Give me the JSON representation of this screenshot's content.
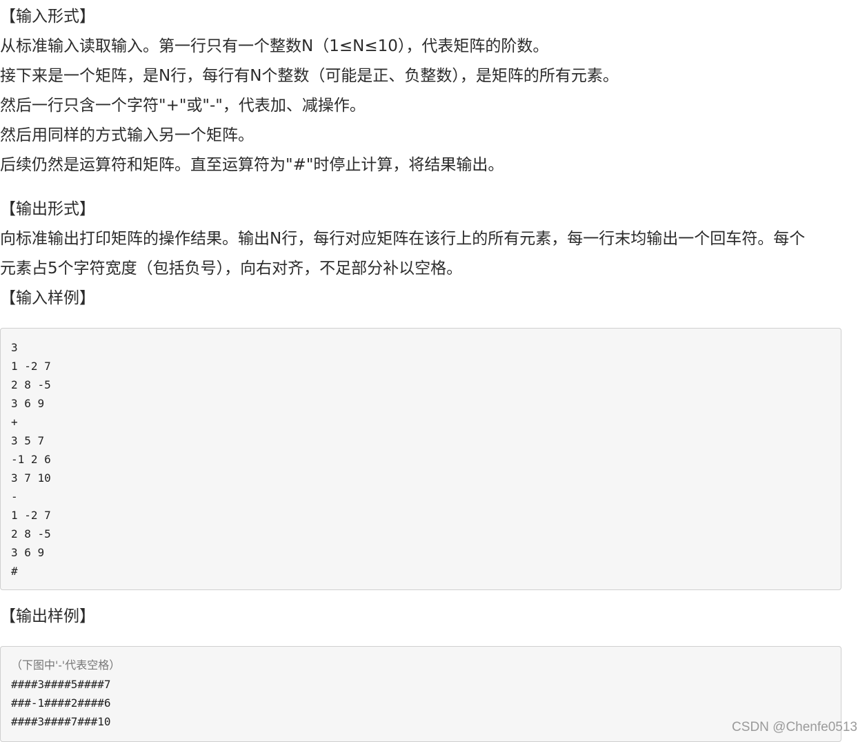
{
  "input_format": {
    "heading": "【输入形式】",
    "lines": [
      "从标准输入读取输入。第一行只有一个整数N（1≤N≤10），代表矩阵的阶数。",
      "接下来是一个矩阵，是N行，每行有N个整数（可能是正、负整数），是矩阵的所有元素。",
      "然后一行只含一个字符\"+\"或\"-\"，代表加、减操作。",
      "然后用同样的方式输入另一个矩阵。",
      "后续仍然是运算符和矩阵。直至运算符为\"#\"时停止计算，将结果输出。"
    ]
  },
  "output_format": {
    "heading": "【输出形式】",
    "lines": [
      "向标准输出打印矩阵的操作结果。输出N行，每行对应矩阵在该行上的所有元素，每一行末均输出一个回车符。每个",
      "元素占5个字符宽度（包括负号），向右对齐，不足部分补以空格。"
    ]
  },
  "input_sample": {
    "heading": "【输入样例】",
    "lines": [
      "3",
      "1 -2 7",
      "2 8 -5",
      "3 6 9",
      "+",
      "3 5 7",
      "-1 2 6",
      "3 7 10",
      "-",
      "1 -2 7",
      "2 8 -5",
      "3 6 9",
      "#"
    ]
  },
  "output_sample": {
    "heading": "【输出样例】",
    "note": "（下图中'-'代表空格）",
    "lines": [
      "####3####5####7",
      "###-1####2####6",
      "####3####7###10"
    ]
  },
  "watermark": "CSDN @Chenfe0513"
}
